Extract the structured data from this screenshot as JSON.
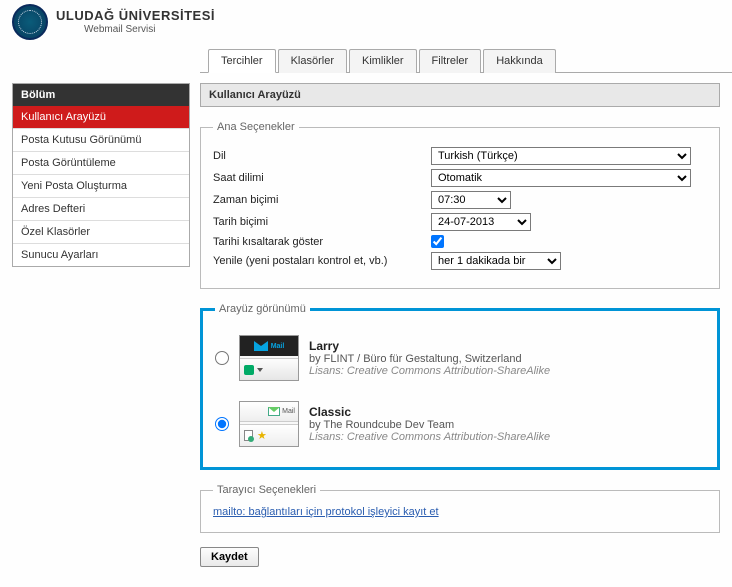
{
  "header": {
    "title": "ULUDAĞ ÜNİVERSİTESİ",
    "subtitle": "Webmail Servisi"
  },
  "tabs": [
    "Tercihler",
    "Klasörler",
    "Kimlikler",
    "Filtreler",
    "Hakkında"
  ],
  "sidebar": {
    "title": "Bölüm",
    "items": [
      "Kullanıcı Arayüzü",
      "Posta Kutusu Görünümü",
      "Posta Görüntüleme",
      "Yeni Posta Oluşturma",
      "Adres Defteri",
      "Özel Klasörler",
      "Sunucu Ayarları"
    ]
  },
  "main": {
    "title": "Kullanıcı Arayüzü",
    "fieldset_main": "Ana Seçenekler",
    "fieldset_skin": "Arayüz görünümü",
    "fieldset_browser": "Tarayıcı Seçenekleri",
    "rows": {
      "language_label": "Dil",
      "language_value": "Turkish (Türkçe)",
      "timezone_label": "Saat dilimi",
      "timezone_value": "Otomatik",
      "timefmt_label": "Zaman biçimi",
      "timefmt_value": "07:30",
      "datefmt_label": "Tarih biçimi",
      "datefmt_value": "24-07-2013",
      "shortdate_label": "Tarihi kısaltarak göster",
      "refresh_label": "Yenile (yeni postaları kontrol et, vb.)",
      "refresh_value": "her 1 dakikada bir"
    },
    "skins": {
      "larry": {
        "name": "Larry",
        "by": "by FLINT / Büro für Gestaltung, Switzerland",
        "license": "Lisans: Creative Commons Attribution-ShareAlike"
      },
      "classic": {
        "name": "Classic",
        "by": "by The Roundcube Dev Team",
        "license": "Lisans: Creative Commons Attribution-ShareAlike"
      }
    },
    "browser_link": "mailto: bağlantıları için protokol işleyici kayıt et",
    "save": "Kaydet"
  }
}
